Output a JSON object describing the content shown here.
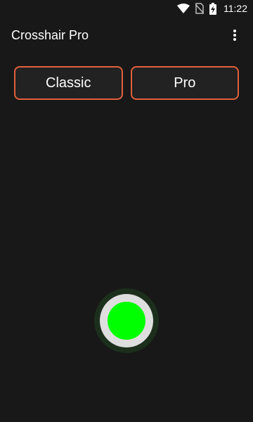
{
  "status_bar": {
    "time": "11:22",
    "icons": [
      "wifi-icon",
      "no-sim-icon",
      "battery-charging-icon"
    ]
  },
  "app_bar": {
    "title": "Crosshair Pro",
    "menu_icon": "more-vert-icon"
  },
  "modes": {
    "classic_label": "Classic",
    "pro_label": "Pro"
  },
  "colors": {
    "background": "#181818",
    "button_border": "#e0603a",
    "dot": "#00ff00"
  }
}
